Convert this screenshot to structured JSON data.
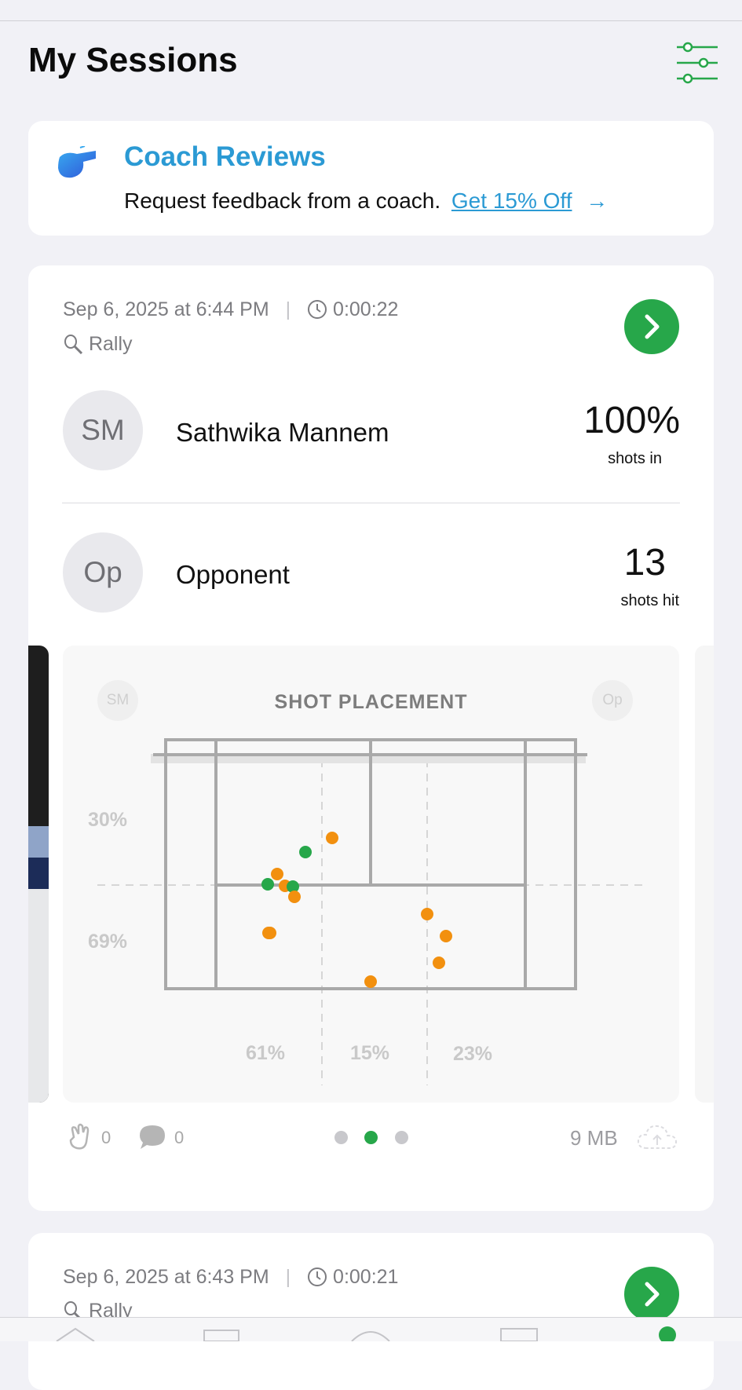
{
  "header": {
    "title": "My Sessions",
    "filter_icon": "sliders-icon"
  },
  "coach": {
    "title": "Coach Reviews",
    "text": "Request feedback from a coach.",
    "link": "Get 15% Off",
    "arrow": "→",
    "icon": "whistle-icon",
    "colors": {
      "accent": "#2b9ad4"
    }
  },
  "session": {
    "date": "Sep 6, 2025 at 6:44 PM",
    "duration": "0:00:22",
    "type": "Rally",
    "player1": {
      "initials": "SM",
      "name": "Sathwika Mannem",
      "stat": "100%",
      "stat_label": "shots in"
    },
    "player2": {
      "initials": "Op",
      "name": "Opponent",
      "stat": "13",
      "stat_label": "shots hit"
    },
    "chart": {
      "title": "SHOT PLACEMENT",
      "left_badge": "SM",
      "right_badge": "Op",
      "depth_top": "30%",
      "depth_bottom": "69%",
      "col_left": "61%",
      "col_mid": "15%",
      "col_right": "23%"
    },
    "footer": {
      "claps": "0",
      "comments": "0",
      "size": "9 MB",
      "page_count": 3,
      "active_page": 2
    }
  },
  "session2": {
    "date": "Sep 6, 2025 at 6:43 PM",
    "duration": "0:00:21",
    "type": "Rally"
  },
  "colors": {
    "green": "#27a74a",
    "orange": "#f2900f",
    "court_line": "#a9a9a9"
  }
}
